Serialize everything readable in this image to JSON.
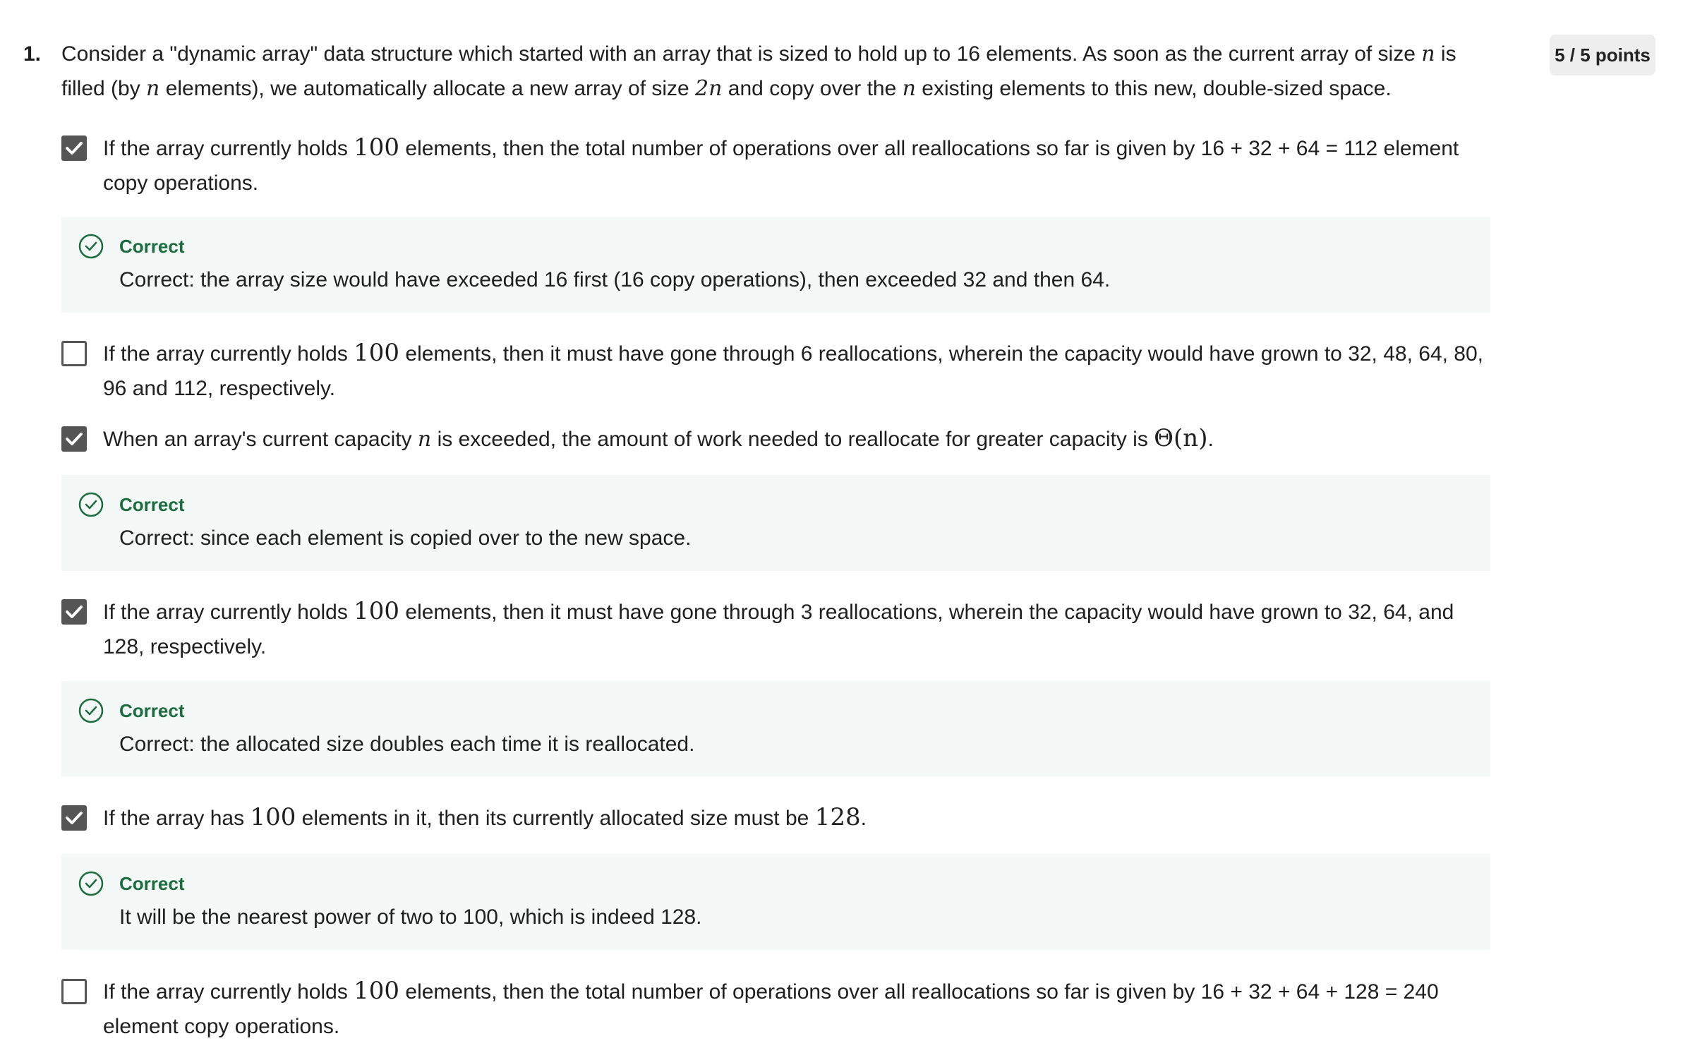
{
  "question": {
    "number": "1.",
    "text_a": "Consider a \"dynamic array\" data structure which started with an array that is sized to hold up to 16 elements. As soon as the current array of size ",
    "var_n": "n",
    "text_b": " is filled (by ",
    "text_c": " elements),  we automatically allocate a new array of size ",
    "var_2n": "2n",
    "text_d": " and copy over the ",
    "text_e": " existing elements to this new, double-sized space."
  },
  "score": "5 / 5 points",
  "options": [
    {
      "checked": true,
      "pre": "If the array currently holds ",
      "math": "100",
      "post": " elements, then the total number of operations over all reallocations so far is given by 16 + 32 + 64  = 112 element copy operations."
    },
    {
      "checked": false,
      "pre": "If the array currently holds ",
      "math": "100",
      "post": " elements, then it must have gone through 6 reallocations, wherein the capacity would have grown to 32, 48,  64, 80, 96 and 112, respectively."
    },
    {
      "checked": true,
      "pre": "When an array's current capacity ",
      "math": "n",
      "post": " is exceeded, the amount of work needed to reallocate for greater capacity is ",
      "math2": "Θ(n)",
      "post2": "."
    },
    {
      "checked": true,
      "pre": "If the array currently holds ",
      "math": "100",
      "post": " elements, then it must have gone through 3 reallocations, wherein the capacity would have grown to 32, 64, and 128, respectively."
    },
    {
      "checked": true,
      "pre": "If the array has ",
      "math": "100",
      "post": " elements in it, then its currently allocated size must be ",
      "math2": "128",
      "post2": "."
    },
    {
      "checked": false,
      "pre": "If the array currently holds ",
      "math": "100",
      "post": " elements, then the total number of operations over all reallocations so far is given by 16 + 32 + 64  + 128 = 240 element copy operations."
    }
  ],
  "feedback": [
    {
      "label": "Correct",
      "text": "Correct: the array size would have exceeded 16 first (16 copy operations), then exceeded 32 and then 64."
    },
    {
      "label": "Correct",
      "text": "Correct: since each element is copied over to the new space."
    },
    {
      "label": "Correct",
      "text": "Correct: the allocated size doubles each time it is reallocated."
    },
    {
      "label": "Correct",
      "text": "It will be the nearest power of two to 100, which is indeed 128."
    }
  ],
  "colors": {
    "correct_green": "#1b6d3f",
    "feedback_bg": "#f4f8f6",
    "checkbox": "#555555"
  },
  "icons": {
    "checked": "check-icon",
    "feedback": "check-circle-icon"
  }
}
